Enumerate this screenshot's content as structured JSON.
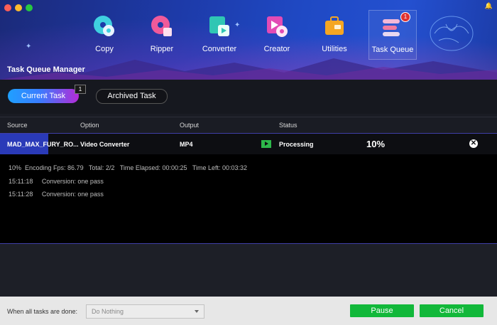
{
  "header": {
    "page_title": "Task Queue Manager",
    "nav": [
      {
        "label": "Copy",
        "icon": "disc-copy-icon"
      },
      {
        "label": "Ripper",
        "icon": "disc-ripper-icon"
      },
      {
        "label": "Converter",
        "icon": "video-converter-icon"
      },
      {
        "label": "Creator",
        "icon": "disc-creator-icon"
      },
      {
        "label": "Utilities",
        "icon": "toolbox-icon"
      },
      {
        "label": "Task Queue",
        "icon": "task-queue-icon",
        "badge": "1",
        "active": true
      }
    ]
  },
  "tabs": {
    "current_label": "Current Task",
    "current_count": "1",
    "archived_label": "Archived Task"
  },
  "table": {
    "columns": [
      "Source",
      "Option",
      "Output",
      "Status"
    ],
    "row": {
      "source": "MAD_MAX_FURY_RO...",
      "option": "Video Converter",
      "output": "MP4",
      "status": "Processing",
      "progress": "10%"
    }
  },
  "log": [
    "10%  Encoding Fps: 86.79   Total: 2/2   Time Elapsed: 00:00:25   Time Left: 00:03:32",
    "15:11:18     Conversion: one pass",
    "15:11:28     Conversion: one pass"
  ],
  "footer": {
    "done_label": "When all tasks are done:",
    "done_value": "Do Nothing",
    "pause_label": "Pause",
    "cancel_label": "Cancel"
  },
  "colors": {
    "accent_green": "#12b83a",
    "header_blue": "#1f49c4",
    "selection_blue": "#2a3ab8"
  }
}
